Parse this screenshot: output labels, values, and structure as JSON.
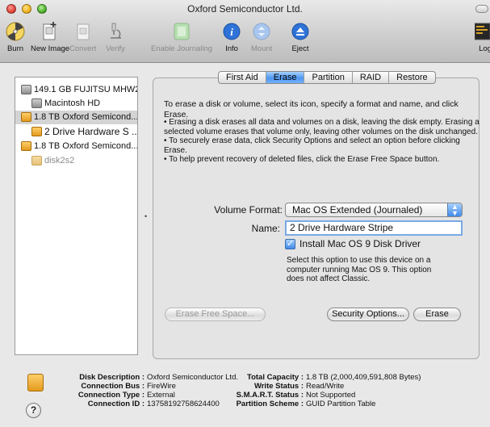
{
  "window": {
    "title": "Oxford Semiconductor Ltd."
  },
  "toolbar": {
    "burn": "Burn",
    "new_image": "New Image",
    "convert": "Convert",
    "verify": "Verify",
    "enable_journaling": "Enable Journaling",
    "info": "Info",
    "mount": "Mount",
    "eject": "Eject",
    "log": "Log"
  },
  "sidebar": {
    "items": [
      {
        "label": "149.1 GB FUJITSU MHW2..."
      },
      {
        "label": "Macintosh HD"
      },
      {
        "label": "1.8 TB Oxford Semicond..."
      },
      {
        "label": "2 Drive Hardware S ..."
      },
      {
        "label": "1.8 TB Oxford Semicond..."
      },
      {
        "label": "disk2s2"
      }
    ]
  },
  "tabs": [
    "First Aid",
    "Erase",
    "Partition",
    "RAID",
    "Restore"
  ],
  "erase": {
    "intro": "To erase a disk or volume, select its icon, specify a format and name, and click Erase.",
    "bullet1": "• Erasing a disk erases all data and volumes on a disk, leaving the disk empty. Erasing a selected volume erases that volume only, leaving other volumes on the disk unchanged.",
    "bullet2": "• To securely erase data, click Security Options and select an option before clicking Erase.",
    "bullet3": "• To help prevent recovery of deleted files, click the Erase Free Space button.",
    "volume_format_label": "Volume Format:",
    "volume_format_value": "Mac OS Extended (Journaled)",
    "name_label": "Name:",
    "name_value": "2 Drive Hardware Stripe",
    "checkbox_label": "Install Mac OS 9 Disk Driver",
    "checkbox_checked": true,
    "help_text": "Select this option to use this device on a computer running Mac OS 9. This option does not affect Classic.",
    "erase_free_space": "Erase Free Space...",
    "security_options": "Security Options...",
    "erase_button": "Erase"
  },
  "footer": {
    "left": [
      {
        "key": "Disk Description :",
        "value": "Oxford Semiconductor Ltd."
      },
      {
        "key": "Connection Bus :",
        "value": "FireWire"
      },
      {
        "key": "Connection Type :",
        "value": "External"
      },
      {
        "key": "Connection ID :",
        "value": "13758192758624400"
      }
    ],
    "right": [
      {
        "key": "Total Capacity :",
        "value": "1.8 TB (2,000,409,591,808 Bytes)"
      },
      {
        "key": "Write Status :",
        "value": "Read/Write"
      },
      {
        "key": "S.M.A.R.T. Status :",
        "value": "Not Supported"
      },
      {
        "key": "Partition Scheme :",
        "value": "GUID Partition Table"
      }
    ],
    "help_glyph": "?"
  },
  "colors": {
    "accent": "#4f97ef",
    "selection": "#d4d4d4",
    "drive_orange": "#e39a1c"
  }
}
